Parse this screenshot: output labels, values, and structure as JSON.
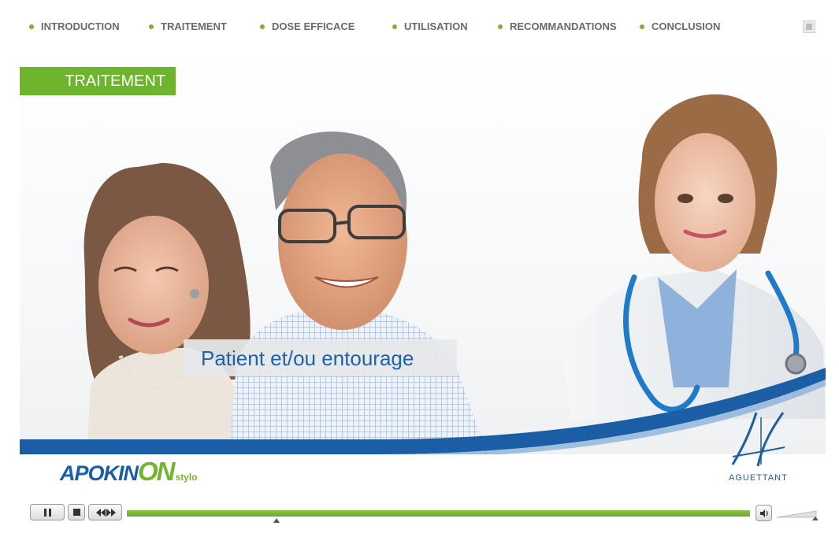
{
  "nav": {
    "items": [
      {
        "label": "INTRODUCTION"
      },
      {
        "label": "TRAITEMENT"
      },
      {
        "label": "DOSE EFFICACE"
      },
      {
        "label": "UTILISATION"
      },
      {
        "label": "RECOMMANDATIONS"
      },
      {
        "label": "CONCLUSION"
      }
    ]
  },
  "slide": {
    "section_tag": "TRAITEMENT",
    "caption": "Patient et/ou entourage",
    "brand": {
      "part1": "APOKIN",
      "part2": "ON",
      "suffix": "stylo"
    },
    "company": "AGUETTANT"
  },
  "player": {
    "progress": 1.0,
    "marker_position": 0.24
  },
  "colors": {
    "accent_green": "#6cb52d",
    "brand_blue": "#1b5ea6"
  }
}
